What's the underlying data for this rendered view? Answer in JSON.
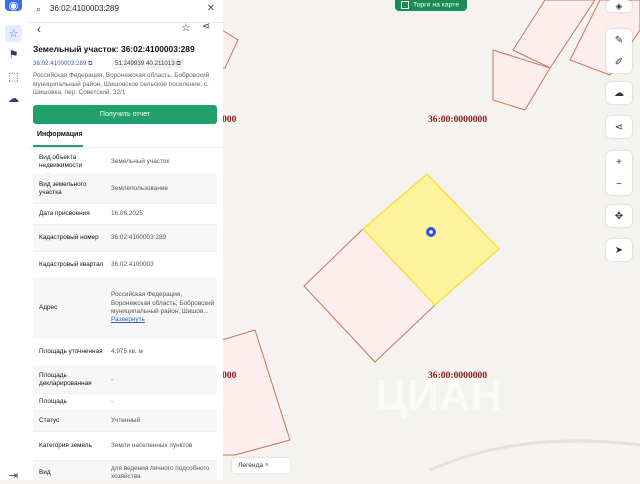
{
  "colors": {
    "accent": "#21a06b",
    "brand": "#2b5ae0",
    "plot_fill": "#fdeeee",
    "plot_stroke": "#c8745f",
    "selected_fill": "#fdf39c",
    "selected_stroke": "#f3e24a"
  },
  "search": {
    "query": "36:02:4100003:289",
    "icon": "search-icon",
    "clear_icon": "close-icon"
  },
  "rail": {
    "logo_icon": "brand-logo-icon",
    "items": [
      {
        "icon": "star-icon"
      },
      {
        "icon": "flag-icon"
      },
      {
        "icon": "select-area-icon"
      },
      {
        "icon": "cloud-icon"
      }
    ],
    "bottom_icon": "logout-icon"
  },
  "card": {
    "title": "Земельный участок: 36:02:4100003:289",
    "cad_chip": "36:02:4100003:289",
    "coords_chip": "51.249939 40.211013",
    "address": "Российская Федерация, Воронежская область, Бобровский муниципальный район, Шишовское сельское поселение, с. Шишовка, пер. Советский, 32/1",
    "report_button": "Получить отчет",
    "tab": "Информация",
    "rows": [
      {
        "k": "Вид объекта недвижимости",
        "v": "Земельный участок",
        "h": 24
      },
      {
        "k": "Вид земельного участка",
        "v": "Землепользование",
        "h": 28
      },
      {
        "k": "Дата присвоения",
        "v": "16.06.2025",
        "h": 20
      },
      {
        "k": "Кадастровый номер",
        "v": "36:02:4100003:289",
        "h": 26
      },
      {
        "k": "Кадастровый квартал",
        "v": "36:02:4100003",
        "h": 26
      },
      {
        "k": "Адрес",
        "v": "Российская Федерация, Воронежская область, Бобровский муниципальный район, Шишов...",
        "link": "Развернуть",
        "h": 58
      },
      {
        "k": "Площадь уточненная",
        "v": "4,975 кв. м",
        "h": 28
      },
      {
        "k": "Площадь декларированная",
        "v": "-",
        "h": 26
      },
      {
        "k": "Площадь",
        "v": "-",
        "h": 16
      },
      {
        "k": "Статус",
        "v": "Учтенный",
        "h": 20
      },
      {
        "k": "Категория земель",
        "v": "Земли населенных пунктов",
        "h": 28
      },
      {
        "k": "Вид",
        "v": "для ведения личного подсобного хозяйства",
        "h": 24
      }
    ]
  },
  "map": {
    "labels": [
      "000",
      "36:00:0000000",
      "000",
      "36:00:0000000"
    ],
    "torgi_label": "Торги на карте",
    "legend_label": "Легенда",
    "watermark": "ЦИАН"
  },
  "controls": {
    "layers_icon": "layers-icon",
    "edit_icon": "pencil-icon",
    "note_icon": "edit-note-icon",
    "upload_icon": "cloud-upload-icon",
    "share_icon": "share-icon",
    "zoom_in": "+",
    "zoom_out": "−",
    "move_icon": "move-icon",
    "locate_icon": "locate-arrow-icon"
  }
}
